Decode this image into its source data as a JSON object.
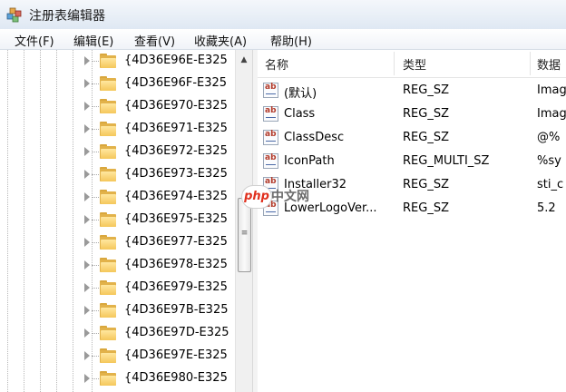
{
  "window": {
    "title": "注册表编辑器"
  },
  "menu": [
    "文件(F)",
    "编辑(E)",
    "查看(V)",
    "收藏夹(A)",
    "帮助(H)"
  ],
  "tree": {
    "items": [
      "{4D36E96E-E325",
      "{4D36E96F-E325",
      "{4D36E970-E325",
      "{4D36E971-E325",
      "{4D36E972-E325",
      "{4D36E973-E325",
      "{4D36E974-E325",
      "{4D36E975-E325",
      "{4D36E977-E325",
      "{4D36E978-E325",
      "{4D36E979-E325",
      "{4D36E97B-E325",
      "{4D36E97D-E325",
      "{4D36E97E-E325",
      "{4D36E980-E325"
    ]
  },
  "list": {
    "columns": {
      "name": "名称",
      "type": "类型",
      "data": "数据"
    },
    "rows": [
      {
        "name": "(默认)",
        "type": "REG_SZ",
        "data": "Imag"
      },
      {
        "name": "Class",
        "type": "REG_SZ",
        "data": "Imag"
      },
      {
        "name": "ClassDesc",
        "type": "REG_SZ",
        "data": "@%"
      },
      {
        "name": "IconPath",
        "type": "REG_MULTI_SZ",
        "data": "%sy"
      },
      {
        "name": "Installer32",
        "type": "REG_SZ",
        "data": "sti_c"
      },
      {
        "name": "LowerLogoVer...",
        "type": "REG_SZ",
        "data": "5.2"
      }
    ]
  },
  "watermark": {
    "logo": "php",
    "text": "中文网"
  }
}
